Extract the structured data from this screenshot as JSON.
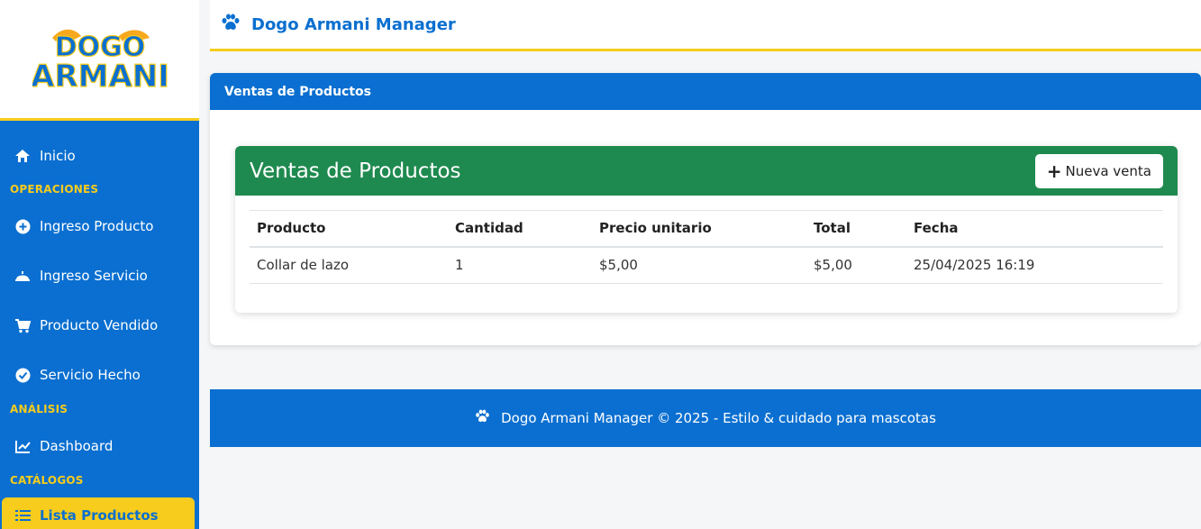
{
  "brand": {
    "logo_top": "DOGO",
    "logo_bottom": "ARMANI"
  },
  "header": {
    "title": "Dogo Armani Manager"
  },
  "sidebar": {
    "home": "Inicio",
    "sections": {
      "operations": "OPERACIONES",
      "analysis": "ANÁLISIS",
      "catalogs": "CATÁLOGOS"
    },
    "items": {
      "ingreso_producto": "Ingreso Producto",
      "ingreso_servicio": "Ingreso Servicio",
      "producto_vendido": "Producto Vendido",
      "servicio_hecho": "Servicio Hecho",
      "dashboard": "Dashboard",
      "lista_productos": "Lista Productos"
    }
  },
  "page": {
    "card_title": "Ventas de Productos",
    "panel_title": "Ventas de Productos",
    "new_button": "Nueva venta"
  },
  "table": {
    "headers": [
      "Producto",
      "Cantidad",
      "Precio unitario",
      "Total",
      "Fecha"
    ],
    "rows": [
      [
        "Collar de lazo",
        "1",
        "$5,00",
        "$5,00",
        "25/04/2025 16:19"
      ]
    ]
  },
  "footer": {
    "text": "Dogo Armani Manager © 2025 - Estilo & cuidado para mascotas"
  },
  "colors": {
    "primary": "#0a6fd0",
    "accent": "#f7cc1c",
    "success": "#1f8a4f"
  }
}
